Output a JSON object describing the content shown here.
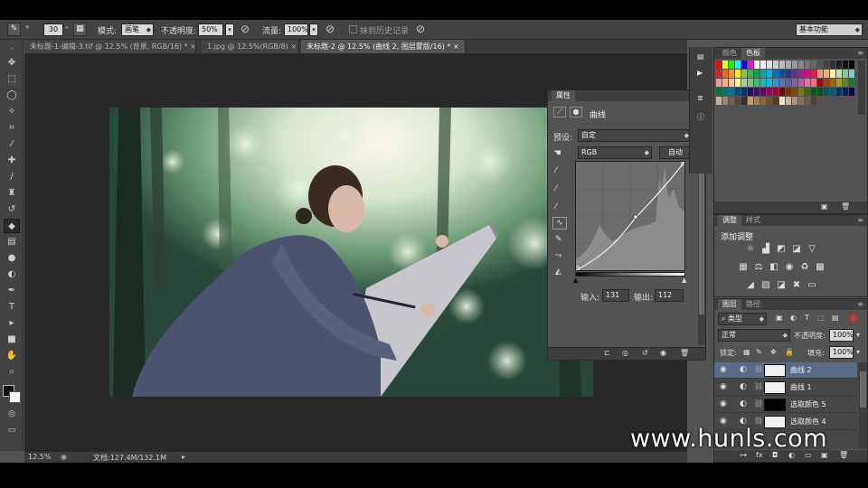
{
  "options_bar": {
    "brush_size": "30",
    "mode_label": "模式:",
    "mode_value": "画笔",
    "opacity_label": "不透明度:",
    "opacity_value": "50%",
    "flow_label": "流量:",
    "flow_value": "100%",
    "history_label": "抹到历史记录",
    "workspace": "基本功能"
  },
  "doc_tabs": [
    {
      "label": "未标题-1-编辑-3.tif @ 12.5% (背景, RGB/16) *"
    },
    {
      "label": "1.jpg @ 12.5%(RGB/8)"
    },
    {
      "label": "未标题-2 @ 12.5% (曲线 2, 图层蒙版/16) *"
    }
  ],
  "status": {
    "zoom": "12.5%",
    "doc_info": "文档:127.4M/132.1M"
  },
  "properties": {
    "tab": "属性",
    "title": "曲线",
    "preset_label": "预设:",
    "preset_value": "自定",
    "channel_value": "RGB",
    "auto_button": "自动",
    "input_label": "输入:",
    "input_value": "131",
    "output_label": "输出:",
    "output_value": "112"
  },
  "swatches_panel": {
    "tab_color": "颜色",
    "tab_swatches": "色板"
  },
  "adjust_panel": {
    "tab_adjust": "调整",
    "tab_styles": "样式",
    "add_label": "添加调整"
  },
  "layers_panel": {
    "tab_layers": "图层",
    "tab_paths": "路径",
    "filter_kind": "类型",
    "blend_mode": "正常",
    "opacity_label": "不透明度:",
    "opacity_value": "100%",
    "lock_label": "锁定:",
    "fill_label": "填充:",
    "fill_value": "100%",
    "layers": [
      {
        "name": "曲线 2",
        "selected": true,
        "thumb": "#f0f0f0"
      },
      {
        "name": "曲线 1",
        "selected": false,
        "thumb": "#f0f0f0"
      },
      {
        "name": "选取颜色 5",
        "selected": false,
        "thumb": "#000000"
      },
      {
        "name": "选取颜色 4",
        "selected": false,
        "thumb": "#f0f0f0"
      }
    ]
  },
  "watermark": "www.hunls.com"
}
